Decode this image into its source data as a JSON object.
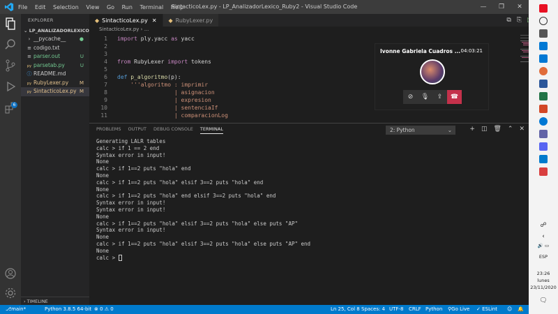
{
  "window": {
    "title": "SintacticoLex.py - LP_AnalizadorLexico_Ruby2 - Visual Studio Code",
    "menu": [
      "File",
      "Edit",
      "Selection",
      "View",
      "Go",
      "Run",
      "Terminal",
      "Help"
    ]
  },
  "sidebar": {
    "header": "EXPLORER",
    "folder": "LP_ANALIZADORLEXICO_R...",
    "files": [
      {
        "name": "__pycache__",
        "status": "",
        "icon": "›"
      },
      {
        "name": "codigo.txt",
        "status": "",
        "icon": "≡"
      },
      {
        "name": "parser.out",
        "status": "U",
        "icon": "≡"
      },
      {
        "name": "parsetab.py",
        "status": "U",
        "icon": "py"
      },
      {
        "name": "README.md",
        "status": "",
        "icon": "ⓘ"
      },
      {
        "name": "RubyLexer.py",
        "status": "M",
        "icon": "py"
      },
      {
        "name": "SintacticoLex.py",
        "status": "M",
        "icon": "py"
      }
    ],
    "timeline": "TIMELINE"
  },
  "tabs": [
    {
      "label": "SintacticoLex.py",
      "active": true
    },
    {
      "label": "RubyLexer.py",
      "active": false
    }
  ],
  "breadcrumb": "SintacticoLex.py › ...",
  "editor": {
    "lines": [
      {
        "n": "1",
        "segments": [
          {
            "t": "import",
            "c": "kw"
          },
          {
            "t": " ply.yacc ",
            "c": "plain"
          },
          {
            "t": "as",
            "c": "kw"
          },
          {
            "t": " yacc",
            "c": "plain"
          }
        ]
      },
      {
        "n": "2",
        "segments": []
      },
      {
        "n": "3",
        "segments": []
      },
      {
        "n": "4",
        "segments": [
          {
            "t": "from",
            "c": "kw"
          },
          {
            "t": " RubyLexer ",
            "c": "plain"
          },
          {
            "t": "import",
            "c": "kw"
          },
          {
            "t": " tokens",
            "c": "plain"
          }
        ]
      },
      {
        "n": "5",
        "segments": []
      },
      {
        "n": "6",
        "segments": [
          {
            "t": "def",
            "c": "kw2"
          },
          {
            "t": " ",
            "c": "plain"
          },
          {
            "t": "p_algoritmo",
            "c": "fn"
          },
          {
            "t": "(p):",
            "c": "plain"
          }
        ]
      },
      {
        "n": "7",
        "segments": [
          {
            "t": "    '''algoritmo : imprimir",
            "c": "str"
          }
        ]
      },
      {
        "n": "8",
        "segments": [
          {
            "t": "                 | asignacion",
            "c": "str"
          }
        ]
      },
      {
        "n": "9",
        "segments": [
          {
            "t": "                 | expresion",
            "c": "str"
          }
        ]
      },
      {
        "n": "10",
        "segments": [
          {
            "t": "                 | sentenciaIf",
            "c": "str"
          }
        ]
      },
      {
        "n": "11",
        "segments": [
          {
            "t": "                 | comparacionLog",
            "c": "str"
          }
        ]
      }
    ]
  },
  "panel": {
    "tabs": [
      "PROBLEMS",
      "OUTPUT",
      "DEBUG CONSOLE",
      "TERMINAL"
    ],
    "terminal_select": "2: Python",
    "terminal_lines": [
      "Generating LALR tables",
      "calc > if 1 == 2 end",
      "Syntax error in input!",
      "None",
      "calc > if 1==2 puts \"hola\" end",
      "None",
      "calc > if 1==2 puts \"hola\" elsif 3==2 puts \"hola\" end",
      "None",
      "calc > if 1==2 puts \"hola\" end elsif 3==2 puts \"hola\" end",
      "Syntax error in input!",
      "Syntax error in input!",
      "None",
      "calc > if 1==2 puts \"hola\" elsif 3==2 puts \"hola\" else puts \"AP\"",
      "Syntax error in input!",
      "None",
      "calc > if 1==2 puts \"hola\" elsif 3==2 puts \"hola\" else puts \"AP\" end",
      "None"
    ],
    "prompt": "calc > "
  },
  "statusbar": {
    "branch": "main*",
    "python": "Python 3.8.5 64-bit",
    "problems": "⊗ 0 ⚠ 0",
    "position": "Ln 25, Col 8",
    "spaces": "Spaces: 4",
    "encoding": "UTF-8",
    "eol": "CRLF",
    "language": "Python",
    "golive": "Go Live",
    "eslint": "✓ ESLint"
  },
  "call": {
    "name": "Ivonne Gabriela Cuadros ...",
    "time": "04:03:21"
  },
  "taskbar": {
    "lang": "ESP",
    "time": "23:26",
    "day": "lunes",
    "date": "23/11/2020"
  },
  "colors": {
    "accent": "#007acc",
    "end_call": "#c4314b",
    "modified": "#e2c08d",
    "untracked": "#73c991"
  }
}
